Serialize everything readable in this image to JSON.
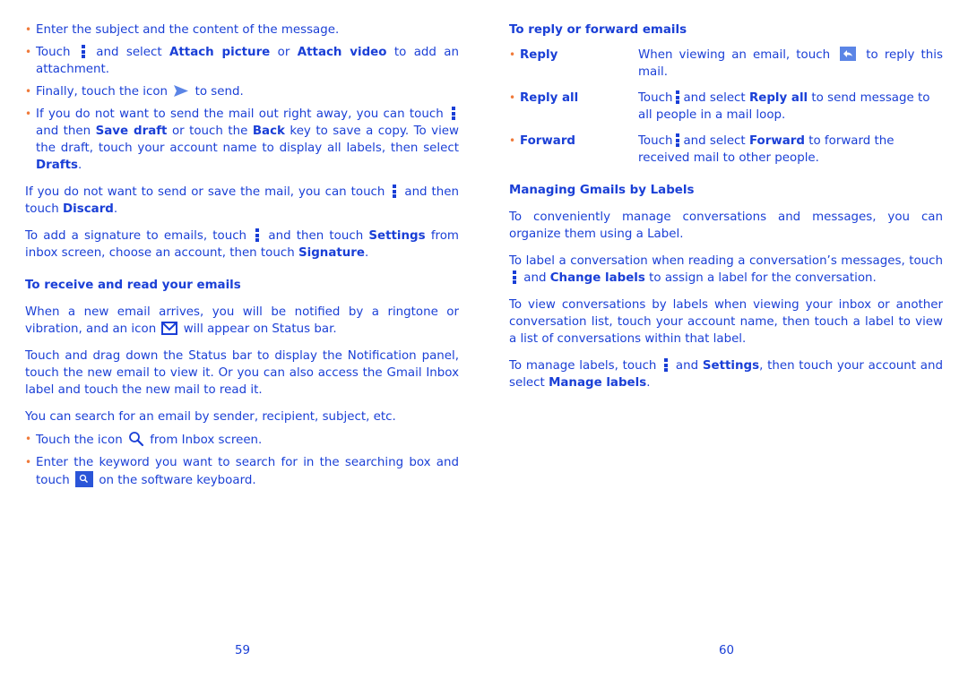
{
  "left_page": {
    "bullets_compose": [
      {
        "text": "Enter the subject and the content of the message."
      },
      {
        "pre": "Touch",
        "mid": "and select",
        "b1": "Attach picture",
        "or": "or",
        "b2": "Attach video",
        "post": "to add an attachment."
      },
      {
        "pre": "Finally, touch the icon",
        "post": "to send."
      },
      {
        "pre": "If you do not want to send the mail out right away, you can touch",
        "mid": "and then",
        "b1": "Save draft",
        "mid2": "or touch the",
        "b2": "Back",
        "mid3": "key to save a copy. To view the draft, touch your account name to display all labels, then select",
        "b3": "Drafts",
        "post": "."
      }
    ],
    "discard_para": {
      "pre": "If you do not want to send or save the mail, you can touch",
      "mid": "and then touch",
      "b1": "Discard",
      "post": "."
    },
    "signature_para": {
      "pre": "To add a signature to emails, touch",
      "mid": "and then touch",
      "b1": "Settings",
      "mid2": "from inbox screen, choose an account, then touch",
      "b2": "Signature",
      "post": "."
    },
    "receive_heading": "To receive and read your emails",
    "notify_para": {
      "pre": "When a new email arrives, you will be notified by a ringtone or vibration, and an icon",
      "post": "will appear on Status bar."
    },
    "drag_para": "Touch and drag down the Status bar to display the Notification panel, touch the new email to view it. Or you can also access the Gmail Inbox label and touch the new mail to read it.",
    "search_para": "You can search for an email by sender, recipient, subject, etc.",
    "search_bullets": [
      {
        "pre": "Touch the icon",
        "post": "from Inbox screen."
      },
      {
        "pre": "Enter the keyword you want to search for in the searching box and touch",
        "post": "on the software keyboard."
      }
    ],
    "page_number": "59"
  },
  "right_page": {
    "reply_heading": "To reply or forward emails",
    "reply_rows": [
      {
        "label": "Reply",
        "pre": "When viewing an email, touch",
        "post": "to reply this mail."
      },
      {
        "label": "Reply all",
        "pre": "Touch",
        "mid": "and select",
        "b": "Reply all",
        "post": "to send message to all people in a mail loop."
      },
      {
        "label": "Forward",
        "pre": "Touch",
        "mid": "and select",
        "b": "Forward",
        "post": "to forward the received mail to other people."
      }
    ],
    "labels_heading": "Managing Gmails by Labels",
    "organize_para": "To conveniently manage conversations and messages, you can organize them using a Label.",
    "label_conv_para": {
      "pre": "To label a conversation when reading a conversation’s messages, touch",
      "mid": "and",
      "b": "Change labels",
      "post": "to assign a label for the conversation."
    },
    "view_para": "To view conversations by labels when viewing your inbox or another conversation list, touch your account name, then touch a label to view a list of conversations within that label.",
    "manage_para": {
      "pre": "To manage labels, touch",
      "mid": "and",
      "b1": "Settings",
      "mid2": ", then touch your account and select",
      "b2": "Manage labels",
      "post": "."
    },
    "page_number": "60"
  },
  "colors": {
    "text": "#1a3fd6",
    "bullet": "#f07a3a",
    "icon_fill": "#2a55d8",
    "reply_icon": "#5b85e6"
  }
}
